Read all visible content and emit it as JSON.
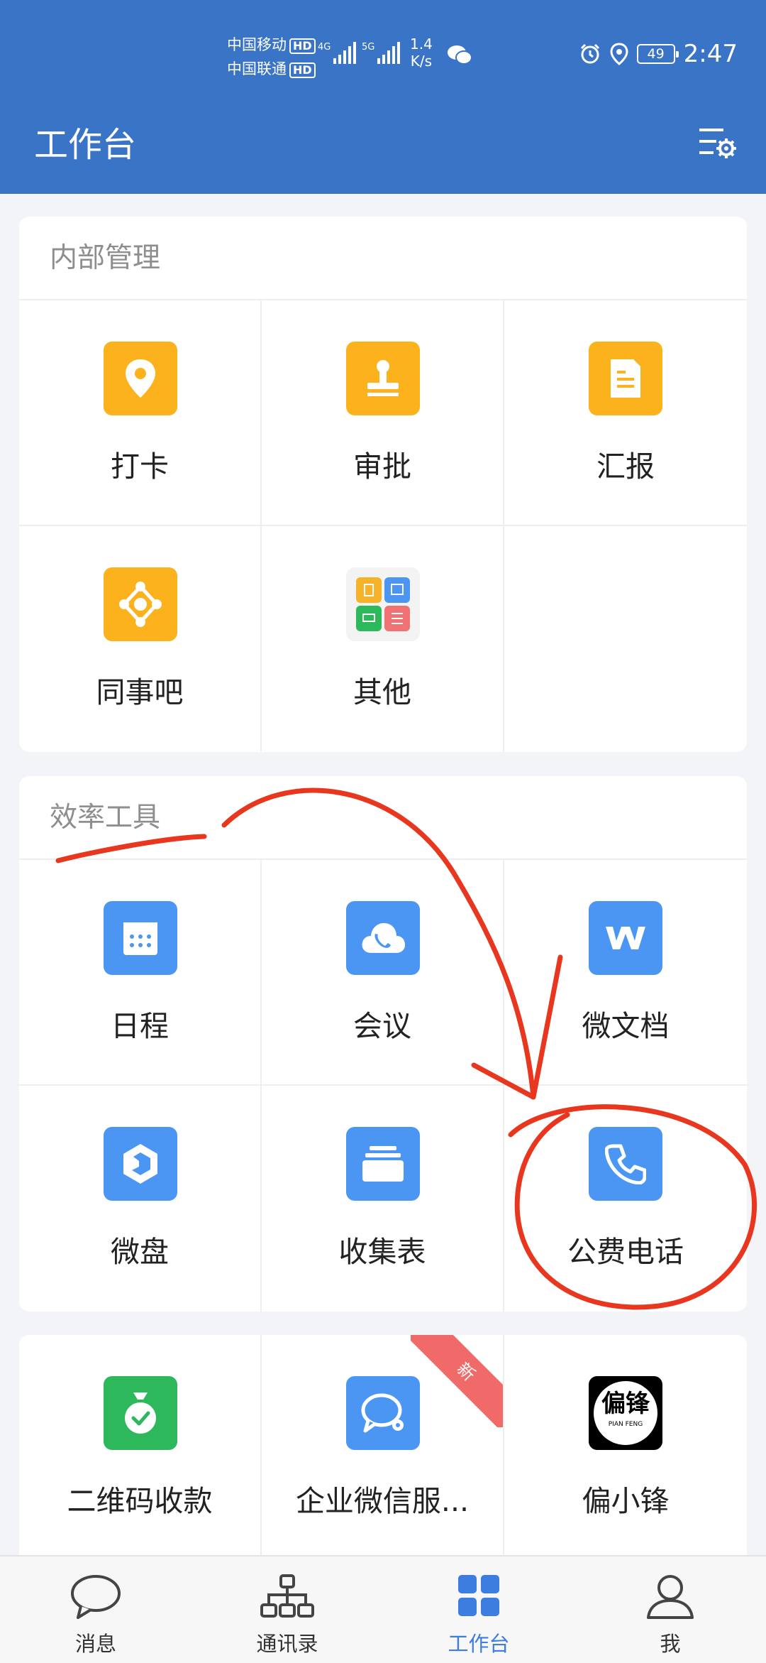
{
  "status_bar": {
    "carrier1": "中国移动",
    "carrier2": "中国联通",
    "hd": "HD",
    "net1": "4G",
    "net2": "5G",
    "speed_value": "1.4",
    "speed_unit": "K/s",
    "battery": "49",
    "time": "2:47"
  },
  "header": {
    "title": "工作台"
  },
  "sections": [
    {
      "title": "内部管理",
      "items": [
        {
          "label": "打卡",
          "icon": "location-pin-icon",
          "color": "#fbb21c"
        },
        {
          "label": "审批",
          "icon": "stamp-icon",
          "color": "#fbb21c"
        },
        {
          "label": "汇报",
          "icon": "report-doc-icon",
          "color": "#fbb21c"
        },
        {
          "label": "同事吧",
          "icon": "network-icon",
          "color": "#fbb21c"
        },
        {
          "label": "其他",
          "icon": "more-apps-icon",
          "color": "#f3f3f3"
        }
      ]
    },
    {
      "title": "效率工具",
      "items": [
        {
          "label": "日程",
          "icon": "calendar-icon",
          "color": "#4c96f3"
        },
        {
          "label": "会议",
          "icon": "cloud-phone-icon",
          "color": "#4c96f3"
        },
        {
          "label": "微文档",
          "icon": "w-doc-icon",
          "color": "#4c96f3"
        },
        {
          "label": "微盘",
          "icon": "drive-icon",
          "color": "#4c96f3"
        },
        {
          "label": "收集表",
          "icon": "stack-icon",
          "color": "#4c96f3"
        },
        {
          "label": "公费电话",
          "icon": "phone-icon",
          "color": "#4c96f3"
        }
      ]
    },
    {
      "title": "",
      "items": [
        {
          "label": "二维码收款",
          "icon": "money-bag-icon",
          "color": "#2db95b"
        },
        {
          "label": "企业微信服...",
          "icon": "service-chat-icon",
          "color": "#4c96f3",
          "badge": "新"
        },
        {
          "label": "偏小锋",
          "icon": "pianfeng-logo-icon",
          "color": "#000000",
          "logo_text": "偏锋",
          "logo_sub": "PIAN FENG"
        }
      ]
    }
  ],
  "bottom_nav": [
    {
      "label": "消息",
      "icon": "chat-bubble-icon"
    },
    {
      "label": "通讯录",
      "icon": "org-chart-icon"
    },
    {
      "label": "工作台",
      "icon": "grid-icon",
      "active": true
    },
    {
      "label": "我",
      "icon": "person-icon"
    }
  ],
  "colors": {
    "header_bg": "#3974c6",
    "accent": "#3d7de0",
    "annotation": "#e8371e"
  }
}
